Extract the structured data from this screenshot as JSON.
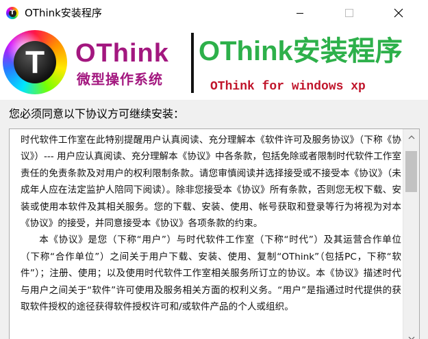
{
  "window": {
    "title": "OThink安装程序",
    "icon_letter": "T"
  },
  "banner": {
    "logo_letter": "T",
    "brand_name": "OThink",
    "brand_sub": "微型操作系统",
    "title": "OThink安装程序",
    "tagline": "OThink for windows xp",
    "colors": {
      "brand": "#a3177f",
      "title": "#2db04a",
      "tagline": "#c0152b"
    }
  },
  "license": {
    "prompt": "您必须同意以下协议方可继续安装：",
    "paragraphs": [
      "时代软件工作室在此特别提醒用户认真阅读、充分理解本《软件许可及服务协议》（下称《协议》）--- 用户应认真阅读、充分理解本《协议》中各条款，包括免除或者限制时代软件工作室责任的免责条款及对用户的权利限制条款。请您审慎阅读并选择接受或不接受本《协议》（未成年人应在法定监护人陪同下阅读）。除非您接受本《协议》所有条款，否则您无权下载、安装或使用本软件及其相关服务。您的下载、安装、使用、帐号获取和登录等行为将视为对本《协议》的接受，并同意接受本《协议》各项条款的约束。",
      "本《协议》是您（下称“用户”）与时代软件工作室（下称“时代”）及其运营合作单位（下称“合作单位”）之间关于用户下载、安装、使用、复制“OThink”（包括PC，下称“软件”）；注册、使用；以及使用时代软件工作室相关服务所订立的协议。本《协议》描述时代与用户之间关于“软件”许可使用及服务相关方面的权利义务。“用户”是指通过时代提供的获取软件授权的途径获得软件授权许可和/或软件产品的个人或组织。"
    ]
  }
}
